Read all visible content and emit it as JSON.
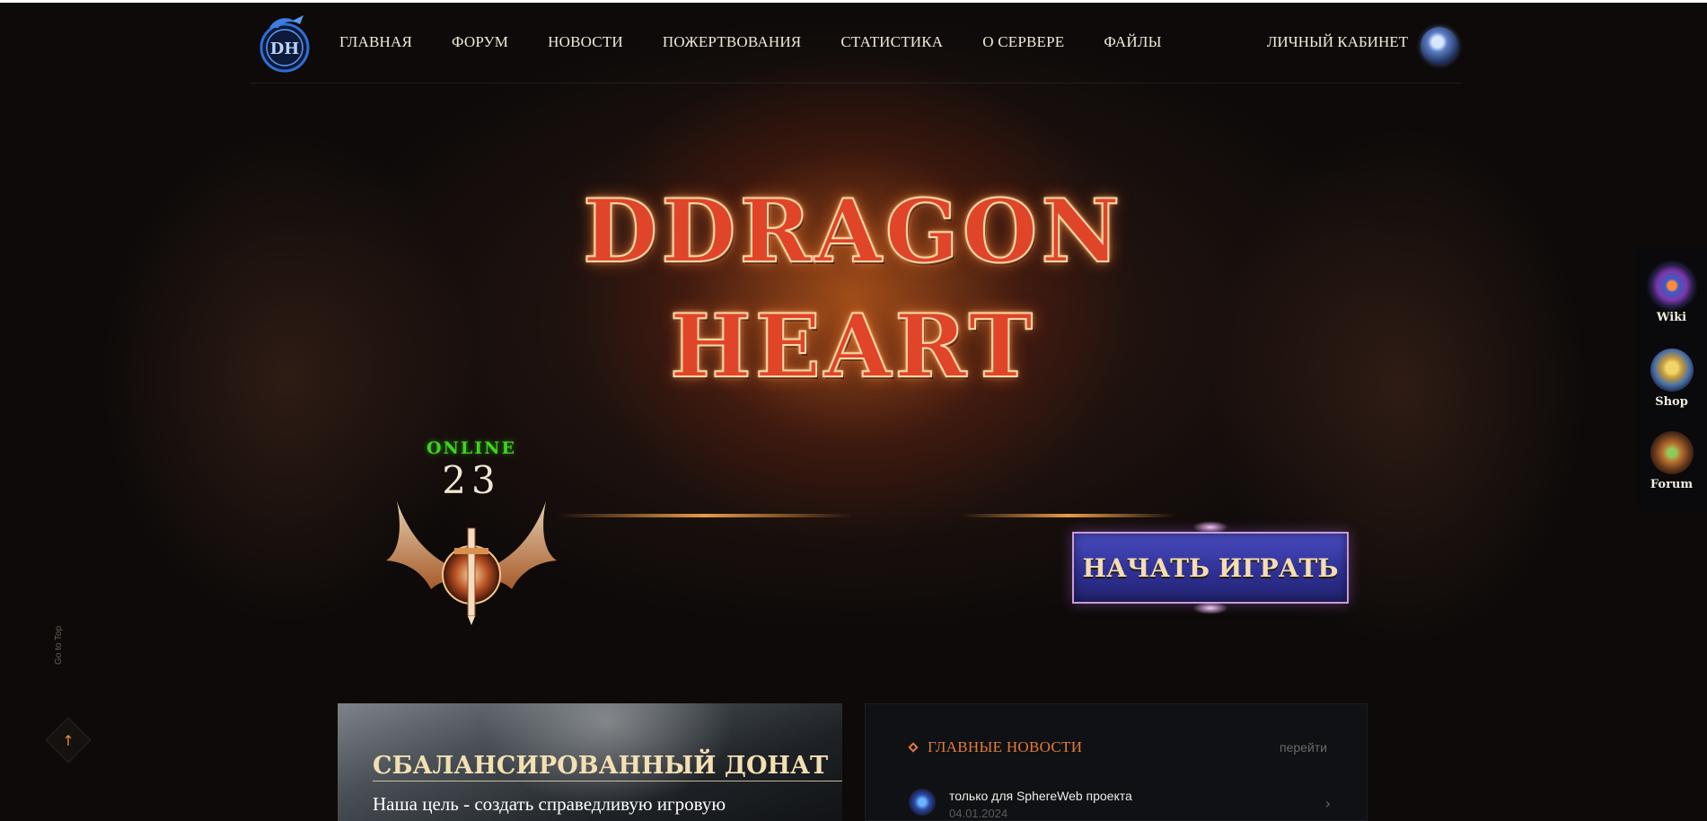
{
  "header": {
    "nav": [
      "ГЛАВНАЯ",
      "ФОРУМ",
      "НОВОСТИ",
      "ПОЖЕРТВОВАНИЯ",
      "СТАТИСТИКА",
      "О СЕРВЕРЕ",
      "ФАЙЛЫ"
    ],
    "cabinet_label": "ЛИЧНЫЙ КАБИНЕТ",
    "logo_text": "DH"
  },
  "hero": {
    "title_line1": "DDRAGON",
    "title_line2": "HEART"
  },
  "online": {
    "label": "ONLINE",
    "count": "23"
  },
  "play_button": {
    "label": "НАЧАТЬ ИГРАТЬ"
  },
  "sidebar": {
    "items": [
      {
        "label": "Wiki",
        "icon": "wiki-icon"
      },
      {
        "label": "Shop",
        "icon": "shop-icon"
      },
      {
        "label": "Forum",
        "icon": "forum-icon"
      }
    ]
  },
  "gototop": {
    "label": "Go to Top"
  },
  "promo": {
    "title": "СБАЛАНСИРОВАННЫЙ ДОНАТ",
    "text": "Наша цель - создать справедливую игровую"
  },
  "news": {
    "title": "ГЛАВНЫЕ НОВОСТИ",
    "more_label": "перейти",
    "items": [
      {
        "title": "только для SphereWeb проекта",
        "date": "04.01.2024"
      }
    ]
  },
  "colors": {
    "accent_orange": "#e37b3a",
    "online_green": "#3ed51c",
    "button_blue": "#2d2f92",
    "title_red": "#e0452a"
  }
}
